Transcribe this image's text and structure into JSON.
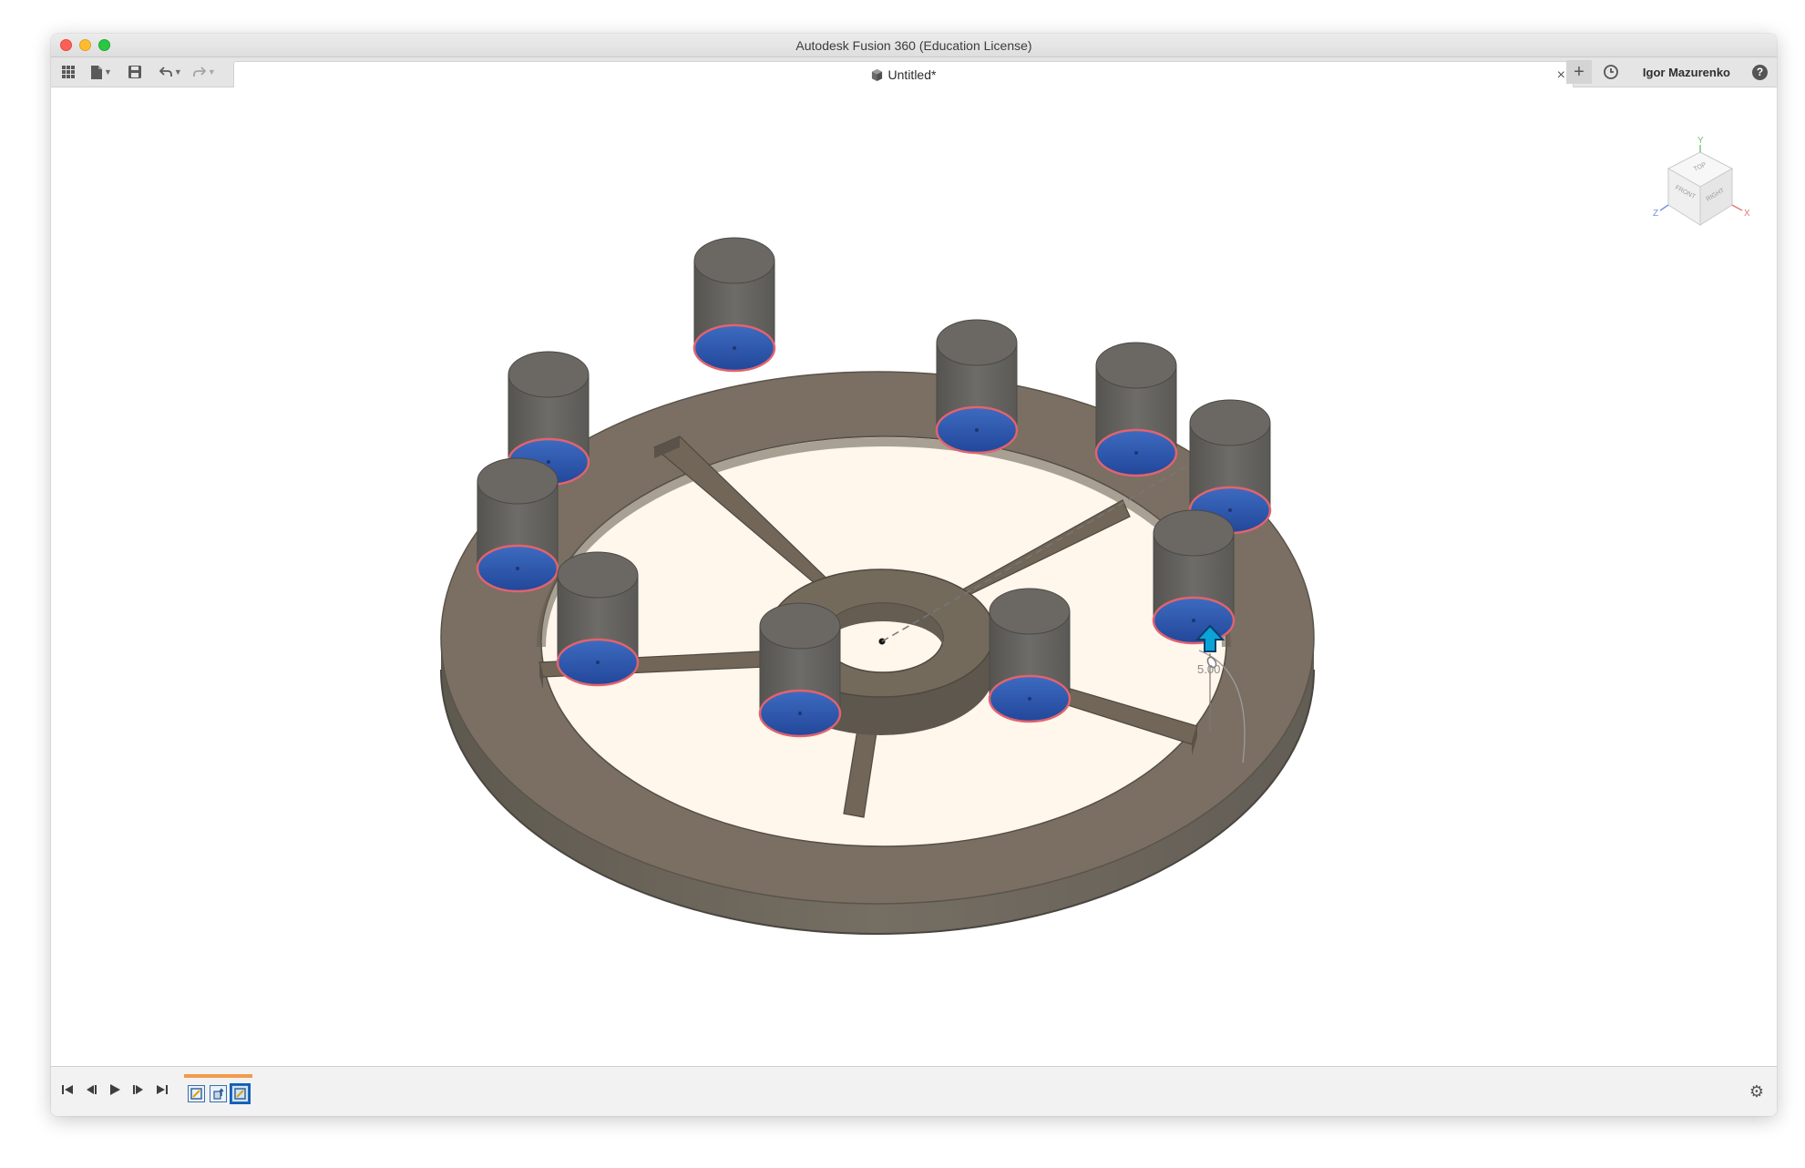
{
  "window": {
    "title": "Autodesk Fusion 360 (Education License)"
  },
  "toolbar": {
    "app_grid_icon": "grid-icon",
    "file_icon": "file-icon",
    "save_icon": "save-icon",
    "undo_icon": "undo-icon",
    "redo_icon": "redo-icon"
  },
  "tab": {
    "title": "Untitled*",
    "close": "×"
  },
  "header_right": {
    "add": "+",
    "user_name": "Igor Mazurenko",
    "help": "?"
  },
  "viewcube": {
    "top": "TOP",
    "front": "FRONT",
    "right": "RIGHT",
    "axis_y": "Y",
    "axis_x": "X",
    "axis_z": "Z"
  },
  "canvas": {
    "dimension_value": "5.00"
  },
  "timeline": {
    "controls": [
      "skip-to-start",
      "step-back",
      "play",
      "step-forward",
      "skip-to-end"
    ],
    "features": [
      "sketch",
      "extrude",
      "sketch"
    ]
  },
  "colors": {
    "body": "#6f6a61",
    "ring_top": "#7b7063",
    "cylinder_top": "#6b6863",
    "selected_face": "#2f5cab",
    "selected_edge": "#e0606a",
    "hole_fill": "#fff6ec"
  }
}
